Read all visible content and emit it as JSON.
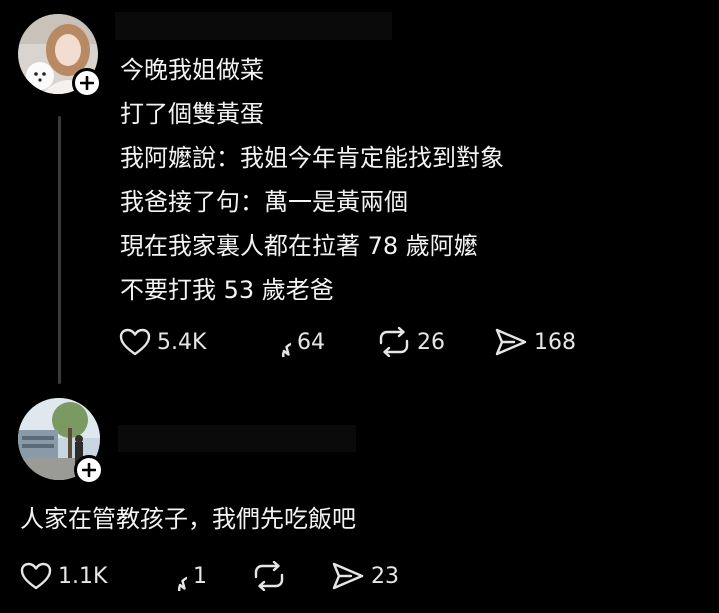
{
  "post": {
    "lines": [
      "今晚我姐做菜",
      "打了個雙黃蛋",
      "我阿嬤說：我姐今年肯定能找到對象",
      "我爸接了句：萬一是黃兩個",
      "現在我家裏人都在拉著 78 歲阿嬤",
      "不要打我 53 歲老爸"
    ],
    "likes": "5.4K",
    "comments": "64",
    "reposts": "26",
    "shares": "168",
    "icons": [
      "heart-icon",
      "comment-icon",
      "repost-icon",
      "share-icon",
      "plus-icon"
    ]
  },
  "reply": {
    "text": "人家在管教孩子，我們先吃飯吧",
    "likes": "1.1K",
    "comments": "1",
    "shares": "23",
    "icons": [
      "heart-icon",
      "comment-icon",
      "repost-icon",
      "share-icon",
      "plus-icon"
    ]
  },
  "colors": {
    "background": "#000000",
    "text": "#f3f3f3",
    "thread_line": "#3a3a3a"
  }
}
